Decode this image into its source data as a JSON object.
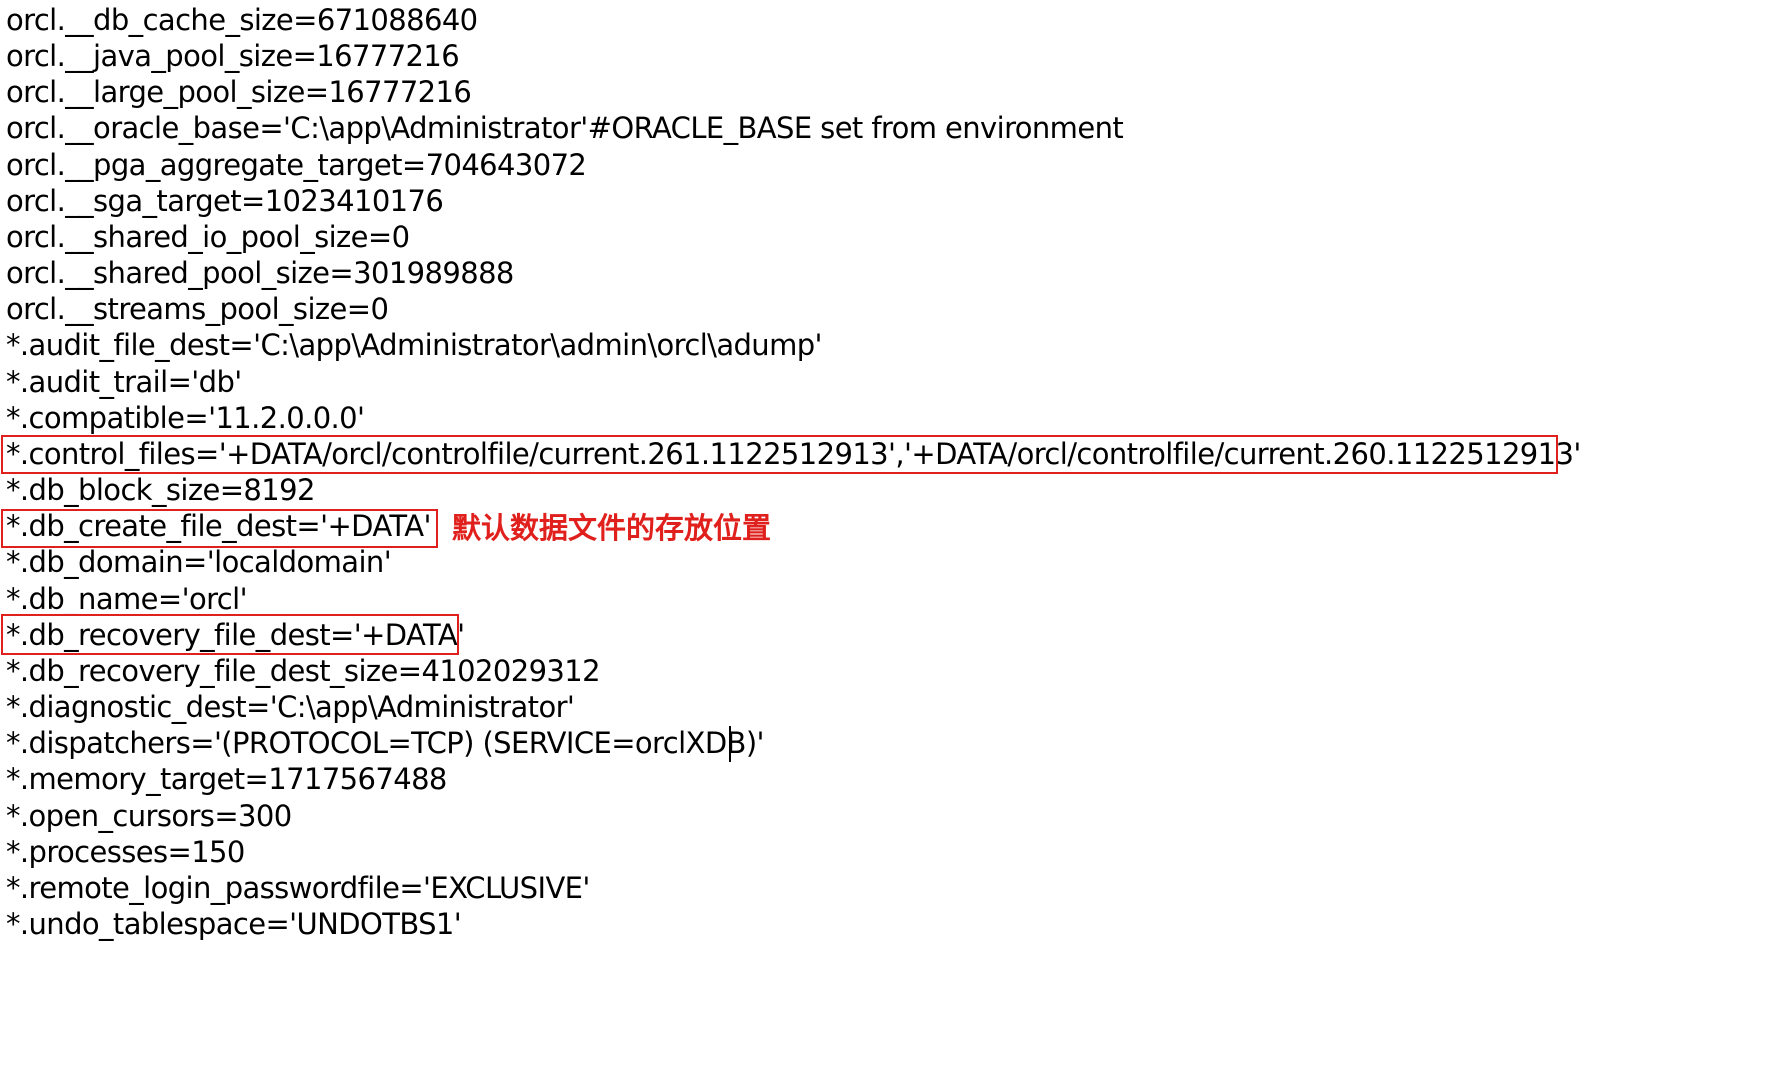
{
  "editor": {
    "lines": [
      "orcl.__db_cache_size=671088640",
      "orcl.__java_pool_size=16777216",
      "orcl.__large_pool_size=16777216",
      "orcl.__oracle_base='C:\\app\\Administrator'#ORACLE_BASE set from environment",
      "orcl.__pga_aggregate_target=704643072",
      "orcl.__sga_target=1023410176",
      "orcl.__shared_io_pool_size=0",
      "orcl.__shared_pool_size=301989888",
      "orcl.__streams_pool_size=0",
      "*.audit_file_dest='C:\\app\\Administrator\\admin\\orcl\\adump'",
      "*.audit_trail='db'",
      "*.compatible='11.2.0.0.0'",
      "*.control_files='+DATA/orcl/controlfile/current.261.1122512913','+DATA/orcl/controlfile/current.260.1122512913'",
      "*.db_block_size=8192",
      "*.db_create_file_dest='+DATA'",
      "*.db_domain='localdomain'",
      "*.db_name='orcl'",
      "*.db_recovery_file_dest='+DATA'",
      "*.db_recovery_file_dest_size=4102029312",
      "*.diagnostic_dest='C:\\app\\Administrator'",
      "*.dispatchers='(PROTOCOL=TCP) (SERVICE=orclXDB)'",
      "*.memory_target=1717567488",
      "*.open_cursors=300",
      "*.processes=150",
      "*.remote_login_passwordfile='EXCLUSIVE'",
      "*.undo_tablespace='UNDOTBS1'"
    ]
  },
  "annotations": {
    "create_file_dest_note": "默认数据文件的存放位置"
  },
  "colors": {
    "highlight": "#e0201c",
    "text": "#000000",
    "background": "#ffffff"
  }
}
